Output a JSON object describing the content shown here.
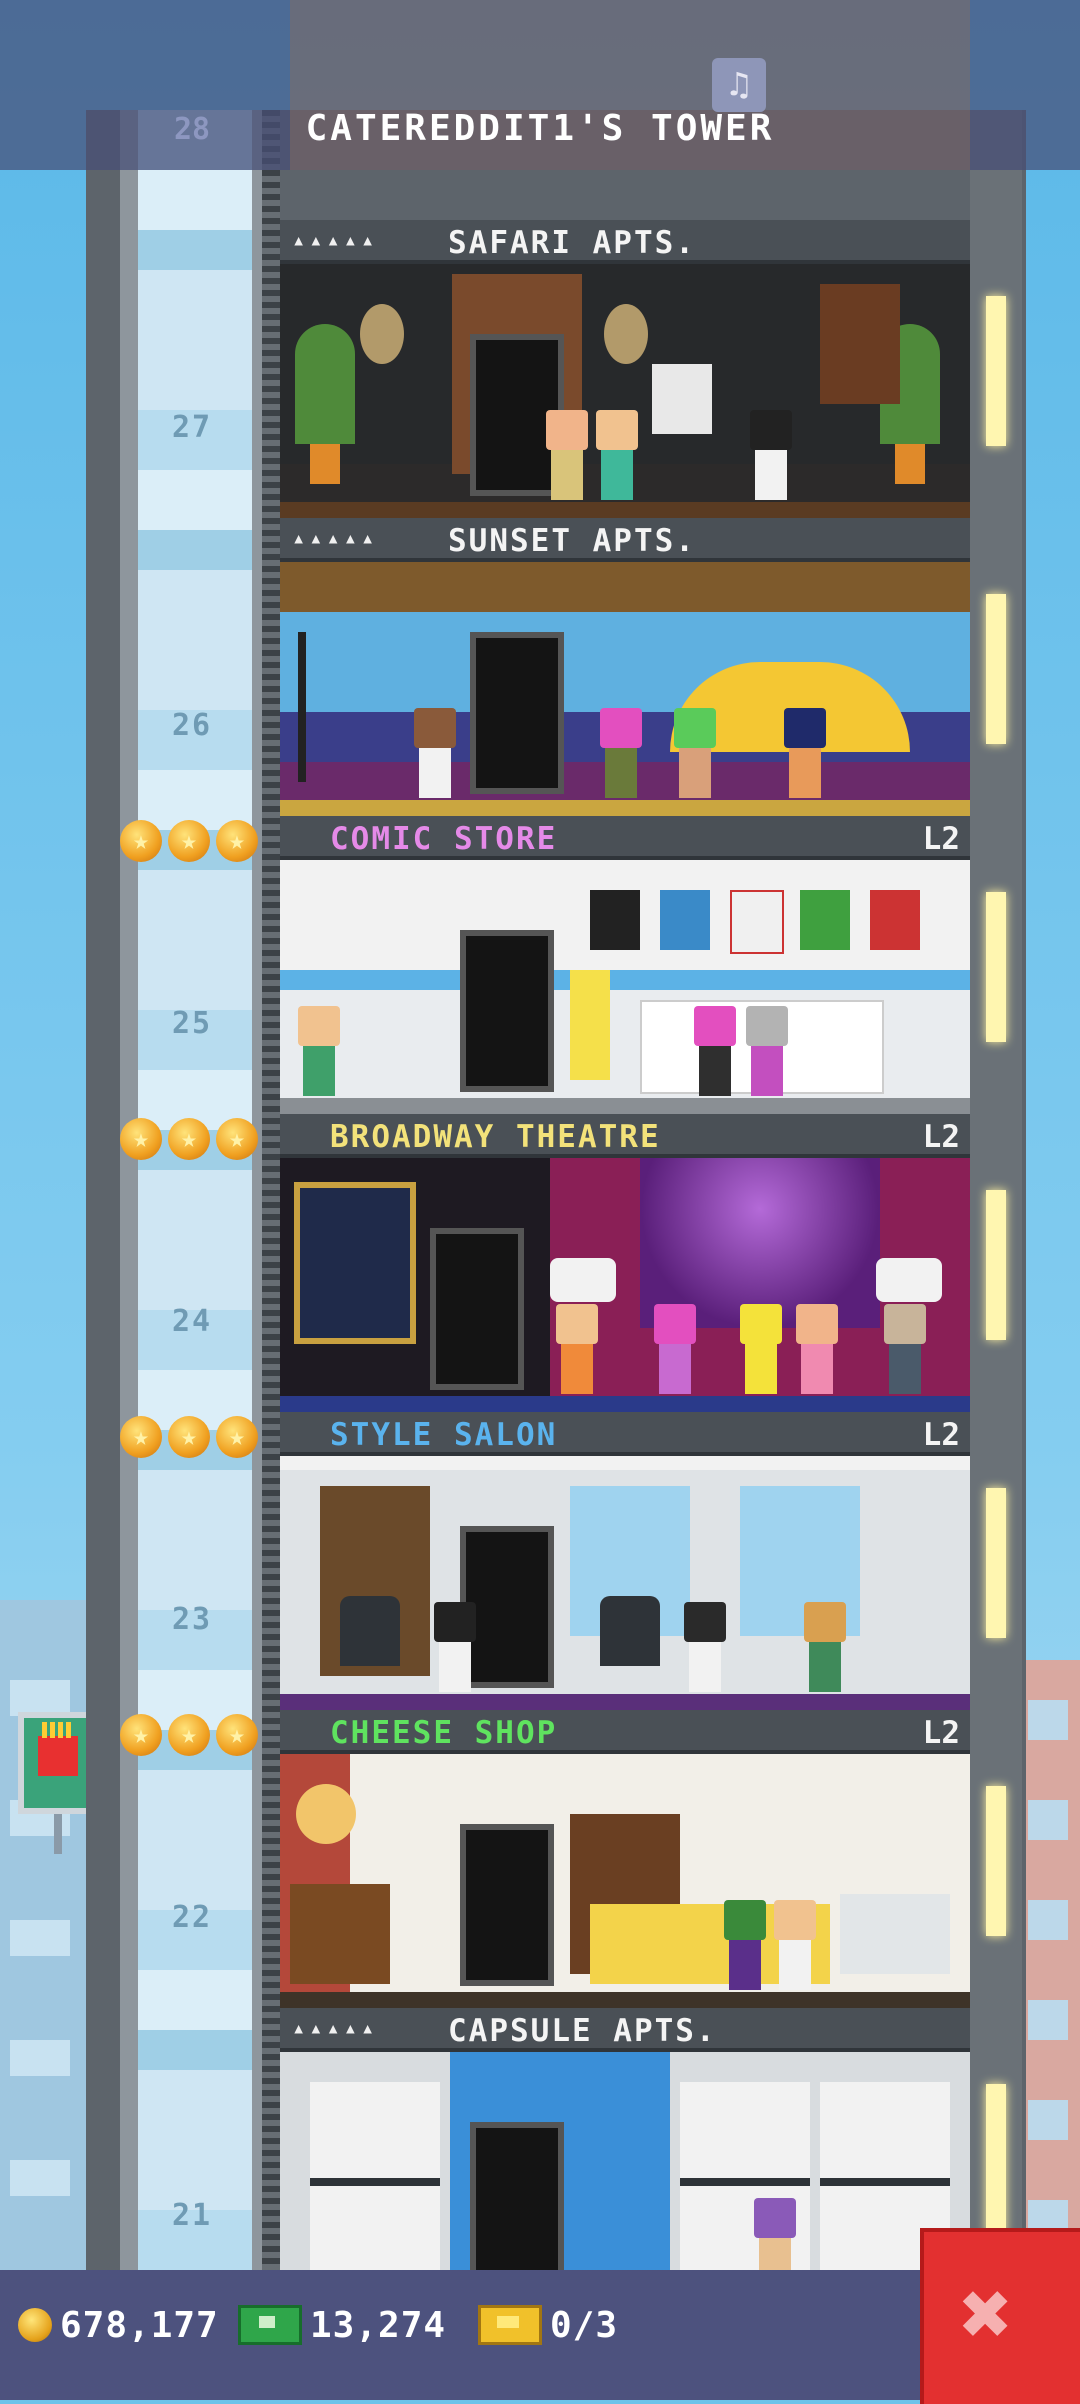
{
  "header": {
    "title": "CATEREDDIT1'S TOWER",
    "top_floor_number": "28",
    "music_icon": "music-note-icon"
  },
  "floors": [
    {
      "number": "27",
      "type": "residential",
      "name": "SAFARI APTS.",
      "occupancy_pips": "▴▴▴▴▴"
    },
    {
      "number": "26",
      "type": "residential",
      "name": "SUNSET APTS.",
      "occupancy_pips": "▴▴▴▴▴"
    },
    {
      "number": "25",
      "type": "business",
      "name": "COMIC STORE",
      "level": "L2",
      "name_color": "#e58ae8"
    },
    {
      "number": "24",
      "type": "business",
      "name": "BROADWAY THEATRE",
      "level": "L2",
      "name_color": "#f3e27a"
    },
    {
      "number": "23",
      "type": "business",
      "name": "STYLE SALON",
      "level": "L2",
      "name_color": "#5ab3ee"
    },
    {
      "number": "22",
      "type": "business",
      "name": "CHEESE SHOP",
      "level": "L2",
      "name_color": "#5fe35f"
    },
    {
      "number": "21",
      "type": "residential",
      "name": "CAPSULE APTS.",
      "occupancy_pips": "▴▴▴▴▴"
    }
  ],
  "status_bar": {
    "coins": "678,177",
    "bux": "13,274",
    "tickets": "0/3",
    "close_icon": "close-icon"
  }
}
